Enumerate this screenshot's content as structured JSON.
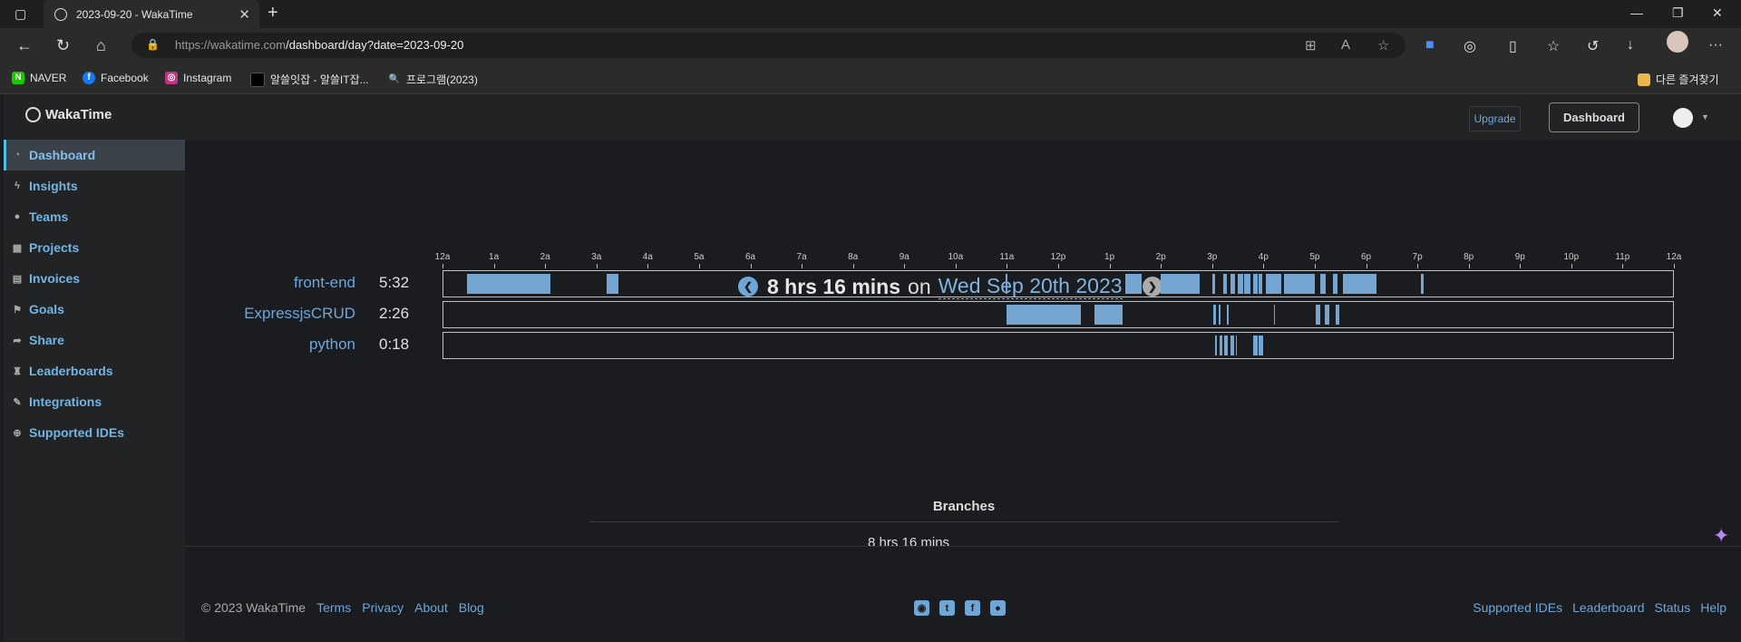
{
  "browser": {
    "tab_title": "2023-09-20 - WakaTime",
    "url_host": "https://wakatime.com",
    "url_path": "/dashboard/day?date=2023-09-20",
    "bookmarks": [
      "NAVER",
      "Facebook",
      "Instagram",
      "알쓸잇잡 - 알쓸IT잡...",
      "프로그램(2023)"
    ],
    "other_bookmarks": "다른 즐겨찾기"
  },
  "app": {
    "logo": "WakaTime",
    "upgrade": "Upgrade",
    "dashboard": "Dashboard"
  },
  "sidebar": {
    "items": [
      {
        "label": "Dashboard",
        "icon": "gauge-icon"
      },
      {
        "label": "Insights",
        "icon": "bolt-icon"
      },
      {
        "label": "Teams",
        "icon": "users-icon"
      },
      {
        "label": "Projects",
        "icon": "grid-icon"
      },
      {
        "label": "Invoices",
        "icon": "file-icon"
      },
      {
        "label": "Goals",
        "icon": "flag-icon"
      },
      {
        "label": "Share",
        "icon": "share-icon"
      },
      {
        "label": "Leaderboards",
        "icon": "trophy-icon"
      },
      {
        "label": "Integrations",
        "icon": "wrench-icon"
      },
      {
        "label": "Supported IDEs",
        "icon": "plus-circle-icon"
      }
    ]
  },
  "summary": {
    "duration": "8 hrs 16 mins",
    "on": "on",
    "date": "Wed Sep 20th 2023",
    "period": "."
  },
  "timeline": {
    "hours": [
      "12a",
      "1a",
      "2a",
      "3a",
      "4a",
      "5a",
      "6a",
      "7a",
      "8a",
      "9a",
      "10a",
      "11a",
      "12p",
      "1p",
      "2p",
      "3p",
      "4p",
      "5p",
      "6p",
      "7p",
      "8p",
      "9p",
      "10p",
      "11p",
      "12a"
    ],
    "projects": [
      {
        "name": "front-end",
        "time": "5:32",
        "segments": [
          [
            0.47,
            2.1
          ],
          [
            3.2,
            3.42
          ],
          [
            10.98,
            11.0
          ],
          [
            13.3,
            13.62
          ],
          [
            14.0,
            14.75
          ],
          [
            15.0,
            15.05
          ],
          [
            15.22,
            15.28
          ],
          [
            15.35,
            15.45
          ],
          [
            15.5,
            15.6
          ],
          [
            15.62,
            15.75
          ],
          [
            15.8,
            15.88
          ],
          [
            15.9,
            15.98
          ],
          [
            16.05,
            16.3
          ],
          [
            16.3,
            16.35
          ],
          [
            16.4,
            17.0
          ],
          [
            17.1,
            17.22
          ],
          [
            17.35,
            17.45
          ],
          [
            17.55,
            18.2
          ],
          [
            19.07,
            19.12
          ]
        ]
      },
      {
        "name": "ExpressjsCRUD",
        "time": "2:26",
        "segments": [
          [
            11.0,
            12.45
          ],
          [
            12.7,
            13.25
          ],
          [
            15.02,
            15.08
          ],
          [
            15.12,
            15.17
          ],
          [
            15.28,
            15.33
          ],
          [
            16.2,
            16.23
          ],
          [
            17.02,
            17.1
          ],
          [
            17.2,
            17.28
          ],
          [
            17.4,
            17.48
          ]
        ]
      },
      {
        "name": "python",
        "time": "0:18",
        "segments": [
          [
            15.05,
            15.1
          ],
          [
            15.15,
            15.2
          ],
          [
            15.24,
            15.3
          ],
          [
            15.35,
            15.42
          ],
          [
            15.46,
            15.48
          ],
          [
            15.8,
            15.88
          ],
          [
            15.9,
            16.0
          ]
        ]
      }
    ]
  },
  "branches": {
    "title": "Branches",
    "total": "8 hrs 16 mins"
  },
  "footer": {
    "copyright": "© 2023 WakaTime",
    "left_links": [
      "Terms",
      "Privacy",
      "About",
      "Blog"
    ],
    "social_icons": [
      "github-icon",
      "twitter-icon",
      "facebook-icon",
      "reddit-icon"
    ],
    "right_links": [
      "Supported IDEs",
      "Leaderboard",
      "Status",
      "Help"
    ]
  }
}
